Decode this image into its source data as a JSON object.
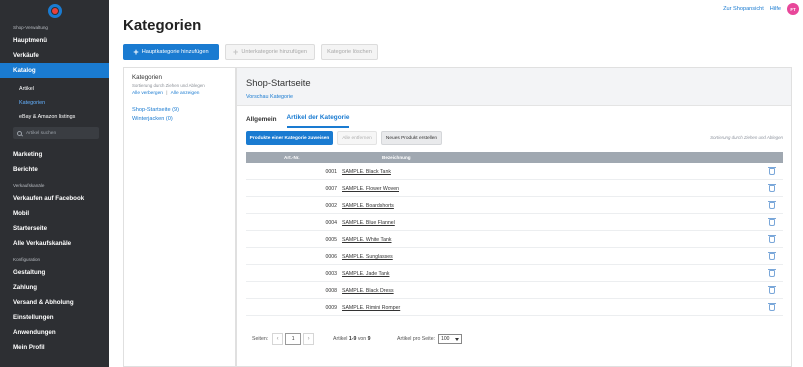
{
  "sidebar": {
    "section_shop": "Shop-Verwaltung",
    "section_channels": "Verkaufskanäle",
    "section_config": "Konfiguration",
    "items": {
      "hauptmenue": "Hauptmenü",
      "verkaeufe": "Verkäufe",
      "katalog": "Katalog",
      "artikel": "Artikel",
      "kategorien": "Kategorien",
      "ebay": "eBay & Amazon listings",
      "search_placeholder": "Artikel suchen",
      "marketing": "Marketing",
      "berichte": "Berichte",
      "facebook": "Verkaufen auf Facebook",
      "mobil": "Mobil",
      "starterseite": "Starterseite",
      "alle_kanaele": "Alle Verkaufskanäle",
      "gestaltung": "Gestaltung",
      "zahlung": "Zahlung",
      "versand": "Versand & Abholung",
      "einstellungen": "Einstellungen",
      "anwendungen": "Anwendungen",
      "mein_profil": "Mein Profil"
    }
  },
  "topbar": {
    "shop_view": "Zur Shopansicht",
    "help": "Hilfe",
    "avatar_initials": "FT"
  },
  "page": {
    "title": "Kategorien",
    "add_main_category": "Hauptkategorie hinzufügen",
    "add_sub_category": "Unterkategorie hinzufügen",
    "delete_category": "Kategorie löschen"
  },
  "categories_panel": {
    "heading": "Kategorien",
    "subtext": "Sortierung durch Ziehen und Ablegen",
    "hide_all": "Alle verbergen",
    "separator": "|",
    "show_all": "Alle anzeigen",
    "items": [
      "Shop-Startseite (9)",
      "Winterjacken (0)"
    ]
  },
  "main_panel": {
    "title": "Shop-Startseite",
    "preview_link": "Vorschau Kategorie",
    "tabs": [
      "Allgemein",
      "Artikel der Kategorie"
    ],
    "assign_button": "Produkte einer Kategorie zuweisen",
    "remove_all_button": "Alle entfernen",
    "new_product_button": "Neues Produkt erstellen",
    "sort_hint": "Sortierung durch Ziehen und Ablegen"
  },
  "table": {
    "headers": {
      "art_nr": "Art.-Nr.",
      "name": "Bezeichnung"
    },
    "rows": [
      {
        "art_nr": "0001",
        "name": "SAMPLE. Black Tank"
      },
      {
        "art_nr": "0007",
        "name": "SAMPLE. Flower Woven"
      },
      {
        "art_nr": "0002",
        "name": "SAMPLE. Boardshorts"
      },
      {
        "art_nr": "0004",
        "name": "SAMPLE. Blue Flannel"
      },
      {
        "art_nr": "0005",
        "name": "SAMPLE. White Tank"
      },
      {
        "art_nr": "0006",
        "name": "SAMPLE. Sunglasses"
      },
      {
        "art_nr": "0003",
        "name": "SAMPLE. Jade Tank"
      },
      {
        "art_nr": "0008",
        "name": "SAMPLE. Black Dress"
      },
      {
        "art_nr": "0009",
        "name": "SAMPLE. Rimini Romper"
      }
    ]
  },
  "pagination": {
    "pages_label": "Seiten:",
    "prev": "‹",
    "current_page": "1",
    "next": "›",
    "articles_label": "Artikel",
    "range": "1-9",
    "of": "von",
    "total": "9",
    "per_page_label": "Artikel pro Seite:",
    "per_page_value": "100"
  },
  "colors": {
    "accent": "#1a7bd1",
    "sidebar_bg": "#2d2f33",
    "table_header": "#a0a8b1"
  }
}
